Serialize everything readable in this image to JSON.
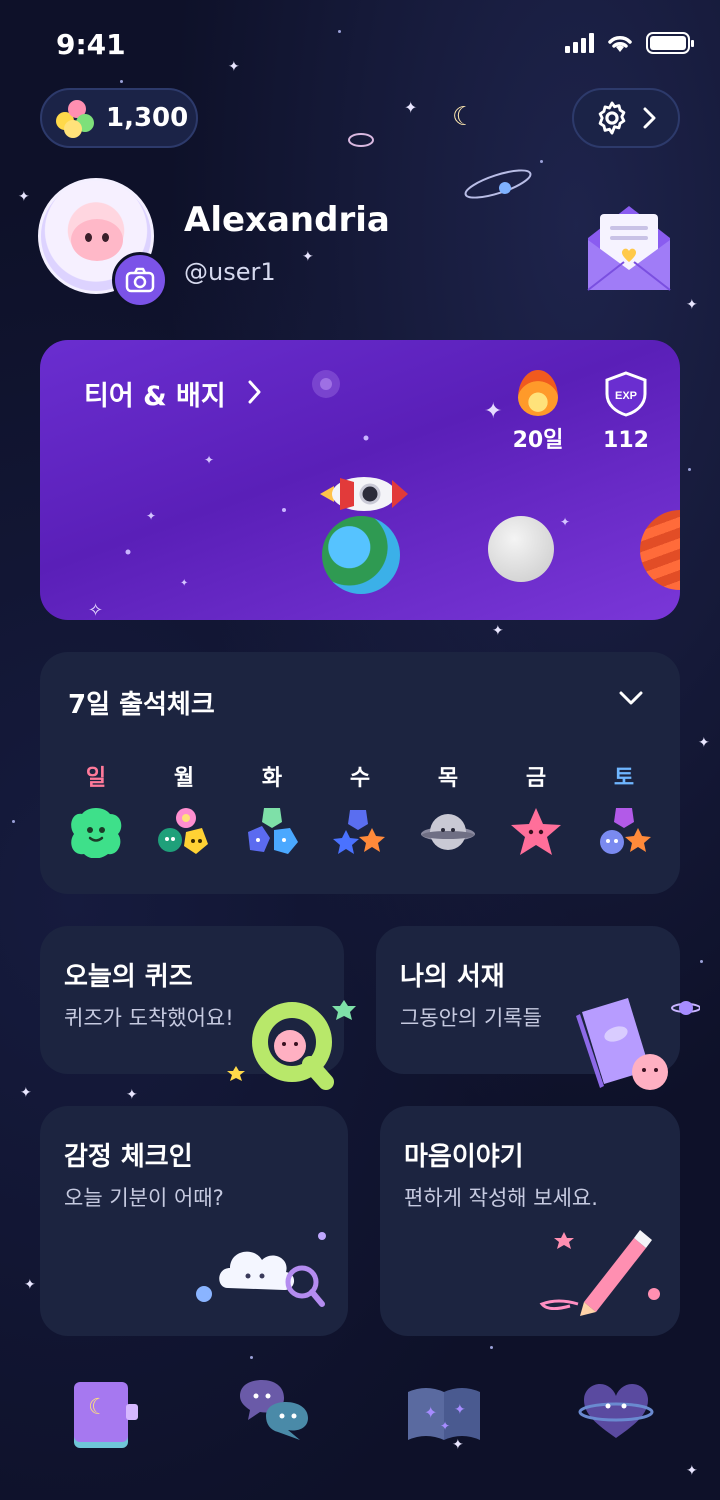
{
  "status_bar": {
    "time": "9:41"
  },
  "wallet": {
    "coins": "1,300",
    "coin_icon": "flower-coin-icon"
  },
  "settings": {
    "icon": "gear-icon",
    "chevron": "chevron-right-icon"
  },
  "profile": {
    "name": "Alexandria",
    "handle": "@user1",
    "camera_icon": "camera-icon",
    "mail_icon": "mail-heart-icon"
  },
  "tier": {
    "title": "티어 & 배지",
    "streak_value": "20일",
    "exp_badge": "EXP",
    "exp_value": "112"
  },
  "attendance": {
    "title": "7일 출석체크",
    "days": [
      {
        "label": "일",
        "color": "#ff7a9a"
      },
      {
        "label": "월",
        "color": "#ffffff"
      },
      {
        "label": "화",
        "color": "#ffffff"
      },
      {
        "label": "수",
        "color": "#ffffff"
      },
      {
        "label": "목",
        "color": "#ffffff"
      },
      {
        "label": "금",
        "color": "#ffffff"
      },
      {
        "label": "토",
        "color": "#6fb6ff"
      }
    ]
  },
  "cards": {
    "quiz": {
      "title": "오늘의 퀴즈",
      "subtitle": "퀴즈가 도착했어요!"
    },
    "library": {
      "title": "나의 서재",
      "subtitle": "그동안의 기록들"
    },
    "emotion": {
      "title": "감정 체크인",
      "subtitle": "오늘 기분이 어때?"
    },
    "story": {
      "title": "마음이야기",
      "subtitle": "편하게 작성해 보세요."
    }
  },
  "bottom_nav": {
    "items": [
      {
        "icon": "diary-book-icon"
      },
      {
        "icon": "chat-bubbles-icon"
      },
      {
        "icon": "open-book-icon"
      },
      {
        "icon": "heart-planet-icon"
      }
    ]
  }
}
